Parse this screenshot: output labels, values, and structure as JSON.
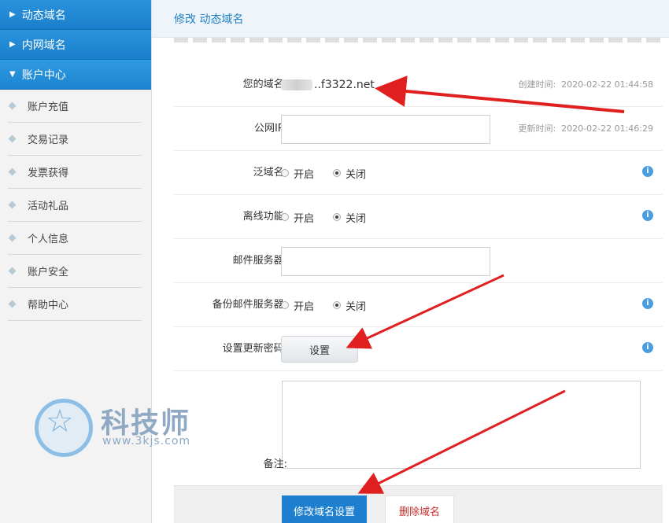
{
  "sidebar": {
    "sections": [
      {
        "label": "动态域名",
        "expanded": false
      },
      {
        "label": "内网域名",
        "expanded": false
      },
      {
        "label": "账户中心",
        "expanded": true
      }
    ],
    "items": [
      "账户充值",
      "交易记录",
      "发票获得",
      "活动礼品",
      "个人信息",
      "账户安全",
      "帮助中心"
    ]
  },
  "page": {
    "title": "修改 动态域名"
  },
  "form": {
    "domain": {
      "label": "您的域名:",
      "value": "..f3322.net",
      "created_label": "创建时间:",
      "created": "2020-02-22 01:44:58"
    },
    "public_ip": {
      "label": "公网IP:",
      "value": "",
      "updated_label": "更新时间:",
      "updated": "2020-02-22 01:46:29"
    },
    "wildcard": {
      "label": "泛域名:",
      "option_on": "开启",
      "option_off": "关闭",
      "selected": "关闭"
    },
    "offline": {
      "label": "离线功能:",
      "option_on": "开启",
      "option_off": "关闭",
      "selected": "关闭"
    },
    "mail_server": {
      "label": "邮件服务器:",
      "value": ""
    },
    "backup_mail": {
      "label": "备份邮件服务器:",
      "option_on": "开启",
      "option_off": "关闭",
      "selected": "关闭"
    },
    "update_password": {
      "label": "设置更新密码:",
      "button": "设置"
    },
    "notes": {
      "label": "备注:",
      "value": ""
    },
    "info_icon": "i"
  },
  "actions": {
    "save": "修改域名设置",
    "delete": "删除域名"
  },
  "watermark": {
    "title": "科技师",
    "url": "www.3kjs.com"
  },
  "colors": {
    "accent": "#1f7fcf",
    "danger": "#d12b2b",
    "arrow": "#e02020"
  }
}
